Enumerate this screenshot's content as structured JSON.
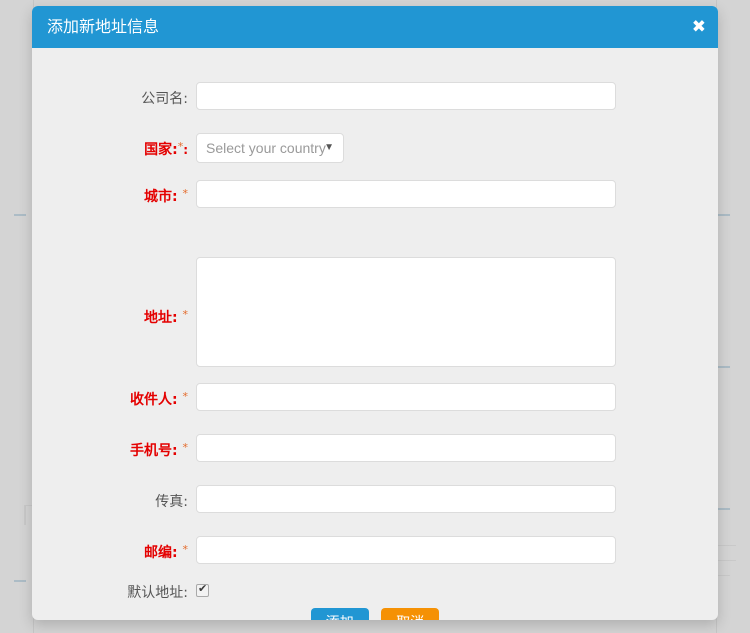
{
  "modal": {
    "title": "添加新地址信息",
    "close_label": "✖",
    "fields": [
      {
        "label": "公司名:",
        "required": false,
        "star": "",
        "colon_after": "",
        "value": "",
        "placeholder": "",
        "type": "text"
      },
      {
        "label": "国家:",
        "required": true,
        "star": "*",
        "colon_after": ":",
        "value": "",
        "placeholder": "",
        "type": "select"
      },
      {
        "label": "城市:",
        "required": true,
        "star": "*",
        "colon_after": "",
        "value": "",
        "placeholder": "",
        "type": "text"
      },
      {
        "label": "地址:",
        "required": true,
        "star": "*",
        "colon_after": "",
        "value": "",
        "placeholder": "",
        "type": "textarea"
      },
      {
        "label": "收件人:",
        "required": true,
        "star": "*",
        "colon_after": "",
        "value": "",
        "placeholder": "",
        "type": "text"
      },
      {
        "label": "手机号:",
        "required": true,
        "star": "*",
        "colon_after": "",
        "value": "",
        "placeholder": "",
        "type": "text"
      },
      {
        "label": "传真:",
        "required": false,
        "star": "",
        "colon_after": "",
        "value": "",
        "placeholder": "",
        "type": "text"
      },
      {
        "label": "邮编:",
        "required": true,
        "star": "*",
        "colon_after": "",
        "value": "",
        "placeholder": "",
        "type": "text"
      },
      {
        "label": "默认地址:",
        "required": false,
        "star": "",
        "colon_after": "",
        "value": "",
        "placeholder": "",
        "type": "checkbox"
      }
    ],
    "country_select": {
      "selected": "Select your country",
      "caret": "▼"
    },
    "checkbox": {
      "checked": true
    },
    "buttons": {
      "submit_label": "添加",
      "cancel_label": "取消"
    },
    "colors": {
      "header": "#2196d3",
      "submit": "#2196d3",
      "cancel": "#f59104",
      "required_label": "#e40000",
      "optional_label": "#555555",
      "body": "#eeeeee",
      "backdrop": "#d4d4d4"
    }
  }
}
